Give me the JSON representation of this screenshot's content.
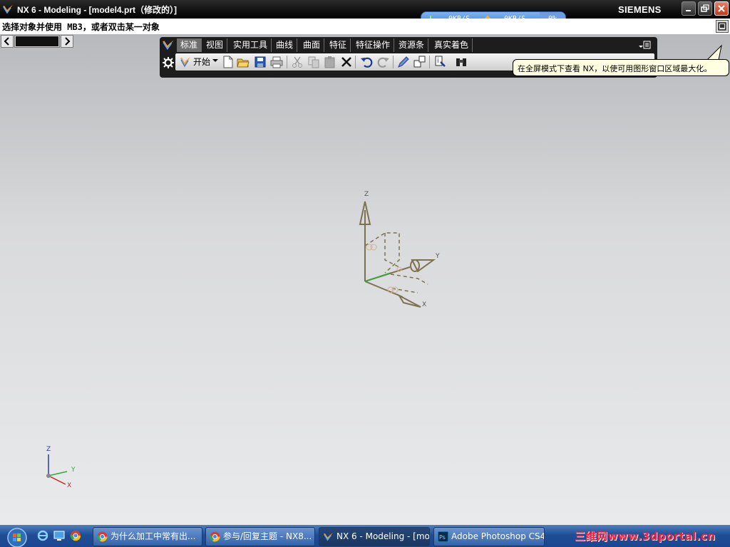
{
  "window": {
    "title": "NX 6 - Modeling - [model4.prt（修改的）]",
    "brand": "SIEMENS"
  },
  "net_monitor": {
    "download": "0KB/S",
    "upload": "0KB/S",
    "percent": "0%"
  },
  "cue_line": {
    "text": "选择对象并使用 MB3，或者双击某一对象"
  },
  "ribbon": {
    "tabs": [
      {
        "label": "标准",
        "active": true
      },
      {
        "label": "视图",
        "active": false
      },
      {
        "label": "实用工具",
        "active": false
      },
      {
        "label": "曲线",
        "active": false
      },
      {
        "label": "曲面",
        "active": false
      },
      {
        "label": "特征",
        "active": false
      },
      {
        "label": "特征操作",
        "active": false
      },
      {
        "label": "资源条",
        "active": false
      },
      {
        "label": "真实着色",
        "active": false
      }
    ],
    "start_label": "开始",
    "tools": [
      "new-file-icon",
      "open-folder-icon",
      "save-icon",
      "print-icon",
      "cut-icon",
      "copy-icon",
      "paste-icon",
      "delete-icon",
      "undo-icon",
      "redo-icon",
      "edit-object-icon",
      "display-icon",
      "info-icon",
      "binoculars-icon"
    ]
  },
  "tooltip": {
    "text": "在全屏模式下查看 NX，以使可用图形窗口区域最大化。"
  },
  "csys": {
    "axis_labels": {
      "x": "X",
      "y": "Y",
      "z": "Z"
    }
  },
  "triad": {
    "axis_labels": {
      "x": "X",
      "y": "Y",
      "z": "Z"
    }
  },
  "taskbar": {
    "tasks": [
      {
        "label": "为什么加工中常有出...",
        "icon": "chrome-icon",
        "active": false
      },
      {
        "label": "参与/回复主题 - NX8...",
        "icon": "chrome-icon",
        "active": false
      },
      {
        "label": "NX 6 - Modeling - [mod...",
        "icon": "nx-icon",
        "active": true
      },
      {
        "label": "Adobe Photoshop CS4...",
        "icon": "photoshop-icon",
        "active": false
      }
    ],
    "watermark": "三维网www.3dportal.cn",
    "colors": {
      "taskbar": "#1f4e95",
      "watermark": "#ff1a3a"
    }
  }
}
